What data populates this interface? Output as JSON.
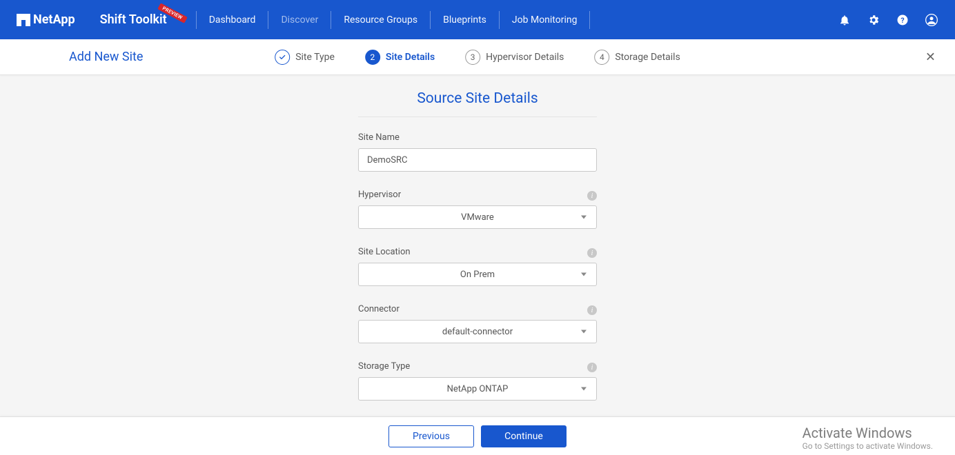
{
  "brand": "NetApp",
  "app_title": "Shift Toolkit",
  "preview_badge": "PREVIEW",
  "nav": {
    "items": [
      {
        "label": "Dashboard"
      },
      {
        "label": "Discover"
      },
      {
        "label": "Resource Groups"
      },
      {
        "label": "Blueprints"
      },
      {
        "label": "Job Monitoring"
      }
    ]
  },
  "page_title": "Add New Site",
  "steps": [
    {
      "label": "Site Type"
    },
    {
      "num": "2",
      "label": "Site Details"
    },
    {
      "num": "3",
      "label": "Hypervisor Details"
    },
    {
      "num": "4",
      "label": "Storage Details"
    }
  ],
  "form": {
    "section_title": "Source Site Details",
    "site_name": {
      "label": "Site Name",
      "value": "DemoSRC"
    },
    "hypervisor": {
      "label": "Hypervisor",
      "value": "VMware"
    },
    "site_location": {
      "label": "Site Location",
      "value": "On Prem"
    },
    "connector": {
      "label": "Connector",
      "value": "default-connector"
    },
    "storage_type": {
      "label": "Storage Type",
      "value": "NetApp ONTAP"
    }
  },
  "actions": {
    "previous": "Previous",
    "continue": "Continue"
  },
  "watermark": {
    "title": "Activate Windows",
    "sub": "Go to Settings to activate Windows."
  }
}
